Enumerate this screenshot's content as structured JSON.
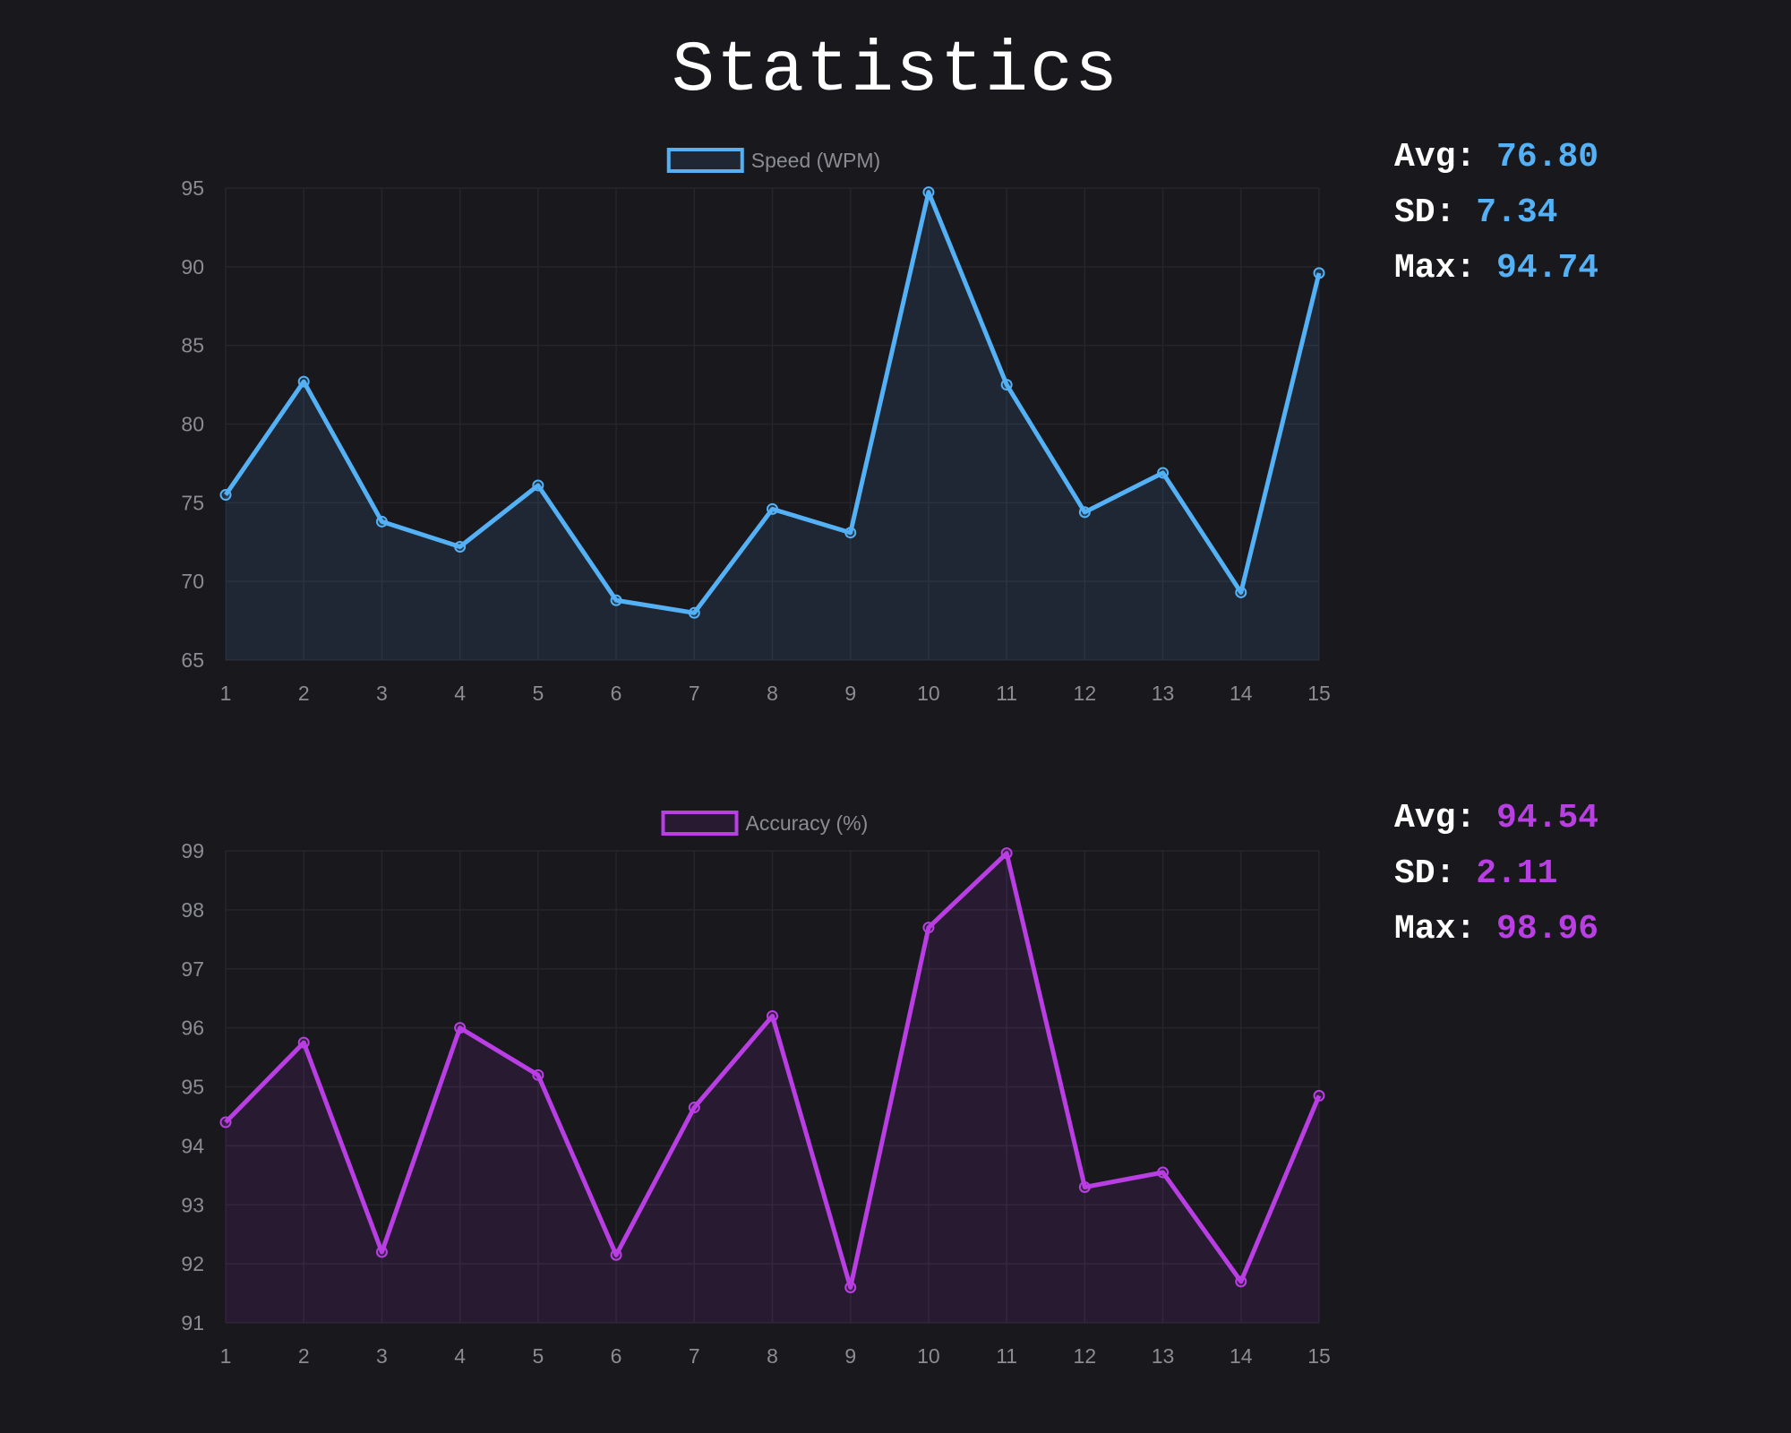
{
  "title": "Statistics",
  "colors": {
    "background": "#18181d",
    "speed": "#54b1f5",
    "accuracy": "#b93ee3",
    "tick_text": "#8b8b93",
    "grid": "#25252b"
  },
  "speed_stats": {
    "avg_label": "Avg:",
    "avg_value": "76.80",
    "sd_label": "SD:",
    "sd_value": "7.34",
    "max_label": "Max:",
    "max_value": "94.74"
  },
  "accuracy_stats": {
    "avg_label": "Avg:",
    "avg_value": "94.54",
    "sd_label": "SD:",
    "sd_value": "2.11",
    "max_label": "Max:",
    "max_value": "98.96"
  },
  "chart_data": [
    {
      "type": "area",
      "legend": "Speed (WPM)",
      "legend_position": "top",
      "x": [
        1,
        2,
        3,
        4,
        5,
        6,
        7,
        8,
        9,
        10,
        11,
        12,
        13,
        14,
        15
      ],
      "series": [
        {
          "name": "Speed (WPM)",
          "color": "#54b1f5",
          "values": [
            75.5,
            82.7,
            73.8,
            72.2,
            76.1,
            68.8,
            68.0,
            74.6,
            73.1,
            94.74,
            82.5,
            74.4,
            76.9,
            69.3,
            89.6
          ]
        }
      ],
      "ylim": [
        65,
        95
      ],
      "yticks": [
        95,
        90,
        85,
        80,
        75,
        70,
        65
      ],
      "grid": true
    },
    {
      "type": "area",
      "legend": "Accuracy (%)",
      "legend_position": "top",
      "x": [
        1,
        2,
        3,
        4,
        5,
        6,
        7,
        8,
        9,
        10,
        11,
        12,
        13,
        14,
        15
      ],
      "series": [
        {
          "name": "Accuracy (%)",
          "color": "#b93ee3",
          "values": [
            94.4,
            95.75,
            92.2,
            96.0,
            95.2,
            92.15,
            94.65,
            96.2,
            91.6,
            97.7,
            98.96,
            93.3,
            93.55,
            91.7,
            94.85
          ]
        }
      ],
      "ylim": [
        91,
        99
      ],
      "yticks": [
        99,
        98,
        97,
        96,
        95,
        94,
        93,
        92,
        91
      ],
      "grid": true
    }
  ]
}
